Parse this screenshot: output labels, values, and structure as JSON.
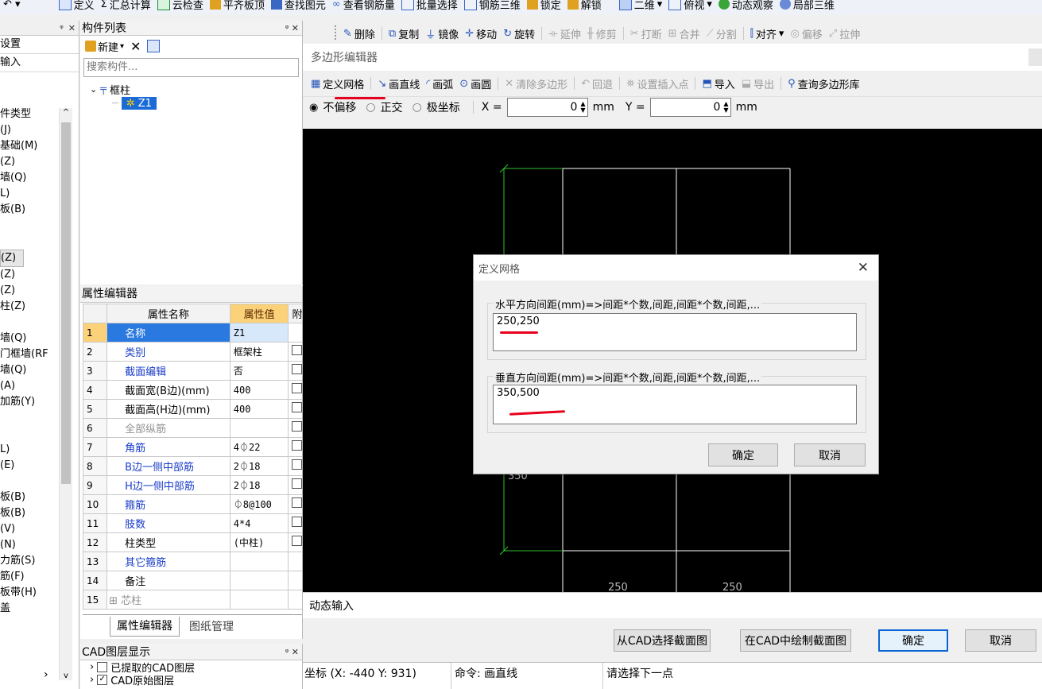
{
  "main_toolbar": {
    "items": [
      "定义",
      "汇总计算",
      "云检查",
      "平齐板顶",
      "查找图元",
      "查看钢筋量",
      "批量选择",
      "钢筋三维",
      "锁定",
      "解锁",
      "二维",
      "俯视",
      "动态观察",
      "局部三维"
    ]
  },
  "left_panel": {
    "top_items": [
      "设置",
      "输入"
    ],
    "items": [
      "件类型",
      "(J)",
      "基础(M)",
      "(Z)",
      "墙(Q)",
      "L)",
      "板(B)",
      "",
      "",
      "(Z)",
      "(Z)",
      "(Z)",
      "柱(Z)",
      "",
      "墙(Q)",
      "门框墙(RF",
      "墙(Q)",
      "(A)",
      "加筋(Y)",
      "",
      "",
      "L)",
      "(E)",
      "",
      "板(B)",
      "板(B)",
      "(V)",
      "(N)",
      "力筋(S)",
      "筋(F)",
      "板带(H)",
      "盖"
    ]
  },
  "component_list": {
    "title": "构件列表",
    "new_label": "新建",
    "search_placeholder": "搜索构件...",
    "tree_root": "框柱",
    "tree_child": "Z1"
  },
  "property_editor": {
    "title": "属性编辑器",
    "headers": [
      "属性名称",
      "属性值",
      "附加"
    ],
    "rows": [
      {
        "n": "1",
        "name": "名称",
        "value": "Z1"
      },
      {
        "n": "2",
        "name": "类别",
        "value": "框架柱"
      },
      {
        "n": "3",
        "name": "截面编辑",
        "value": "否"
      },
      {
        "n": "4",
        "name": "截面宽(B边)(mm)",
        "value": "400"
      },
      {
        "n": "5",
        "name": "截面高(H边)(mm)",
        "value": "400"
      },
      {
        "n": "6",
        "name": "全部纵筋",
        "value": ""
      },
      {
        "n": "7",
        "name": "角筋",
        "value": "4⏀22"
      },
      {
        "n": "8",
        "name": "B边一侧中部筋",
        "value": "2⏀18"
      },
      {
        "n": "9",
        "name": "H边一侧中部筋",
        "value": "2⏀18"
      },
      {
        "n": "10",
        "name": "箍筋",
        "value": "⏀8@100"
      },
      {
        "n": "11",
        "name": "肢数",
        "value": "4*4"
      },
      {
        "n": "12",
        "name": "柱类型",
        "value": "(中柱)"
      },
      {
        "n": "13",
        "name": "其它箍筋",
        "value": ""
      },
      {
        "n": "14",
        "name": "备注",
        "value": ""
      },
      {
        "n": "15",
        "name": "芯柱",
        "value": ""
      }
    ],
    "tabs": [
      "属性编辑器",
      "图纸管理"
    ]
  },
  "cad_layers": {
    "title": "CAD图层显示",
    "items": [
      "已提取的CAD图层",
      "CAD原始图层"
    ]
  },
  "edit_toolbar": {
    "items": [
      "删除",
      "复制",
      "镜像",
      "移动",
      "旋转",
      "延伸",
      "修剪",
      "打断",
      "合并",
      "分割",
      "对齐",
      "偏移",
      "拉伸"
    ]
  },
  "polygon_editor": {
    "title": "多边形编辑器",
    "toolbar": [
      "定义网格",
      "画直线",
      "画弧",
      "画圆",
      "清除多边形",
      "回退",
      "设置插入点",
      "导入",
      "导出",
      "查询多边形库"
    ],
    "mode_options": [
      "不偏移",
      "正交",
      "极坐标"
    ],
    "x_label": "X =",
    "x_value": "0",
    "y_label": "Y =",
    "y_value": "0",
    "unit": "mm",
    "dim_labels": [
      "350",
      "250",
      "250"
    ],
    "dynamic_input": "动态输入",
    "buttons": [
      "从CAD选择截面图",
      "在CAD中绘制截面图",
      "确定",
      "取消"
    ]
  },
  "define_grid_dialog": {
    "title": "定义网格",
    "horizontal_label": "水平方向间距(mm)=>间距*个数,间距,间距*个数,间距,...",
    "horizontal_value": "250,250",
    "vertical_label": "垂直方向间距(mm)=>间距*个数,间距,间距*个数,间距,...",
    "vertical_value": "350,500",
    "ok": "确定",
    "cancel": "取消"
  },
  "status_bar": {
    "coords": "坐标 (X: -440 Y: 931)",
    "command": "命令: 画直线",
    "prompt": "请选择下一点"
  },
  "colors": {
    "cad_background": "#000000",
    "grid_lines": "#ffffff",
    "dim_lines": "#2ec22e",
    "annotation_red": "#e8001c",
    "selection_blue": "#1a6bd6"
  }
}
